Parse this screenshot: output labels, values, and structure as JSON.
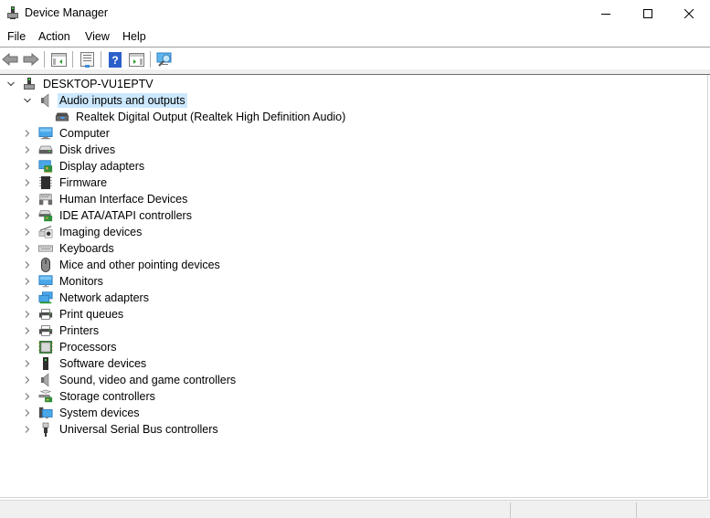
{
  "window": {
    "title": "Device Manager",
    "icon": "device-manager-icon",
    "controls": {
      "minimize": "minimize-icon",
      "maximize": "maximize-icon",
      "close": "close-icon"
    }
  },
  "menubar": {
    "items": [
      {
        "label": "File"
      },
      {
        "label": "Action"
      },
      {
        "label": "View"
      },
      {
        "label": "Help"
      }
    ]
  },
  "toolbar": {
    "buttons": [
      {
        "name": "back",
        "icon": "back-arrow-icon"
      },
      {
        "name": "forward",
        "icon": "forward-arrow-icon"
      },
      {
        "name": "show-hide-console-tree",
        "icon": "console-tree-icon"
      },
      {
        "name": "properties",
        "icon": "properties-icon"
      },
      {
        "name": "help",
        "icon": "help-icon"
      },
      {
        "name": "show-hide-action-pane",
        "icon": "action-pane-icon"
      },
      {
        "name": "scan-hardware",
        "icon": "scan-hardware-icon"
      }
    ]
  },
  "tree": {
    "root": {
      "label": "DESKTOP-VU1EPTV",
      "expanded": true,
      "icon": "computer-tower-icon"
    },
    "categories": [
      {
        "label": "Audio inputs and outputs",
        "icon": "speaker-icon",
        "expanded": true,
        "selected": true,
        "children": [
          {
            "label": "Realtek Digital Output (Realtek High Definition Audio)",
            "icon": "audio-device-icon"
          }
        ]
      },
      {
        "label": "Computer",
        "icon": "computer-icon",
        "expanded": false
      },
      {
        "label": "Disk drives",
        "icon": "disk-drive-icon",
        "expanded": false
      },
      {
        "label": "Display adapters",
        "icon": "display-adapter-icon",
        "expanded": false
      },
      {
        "label": "Firmware",
        "icon": "firmware-chip-icon",
        "expanded": false
      },
      {
        "label": "Human Interface Devices",
        "icon": "hid-icon",
        "expanded": false
      },
      {
        "label": "IDE ATA/ATAPI controllers",
        "icon": "ide-controller-icon",
        "expanded": false
      },
      {
        "label": "Imaging devices",
        "icon": "camera-icon",
        "expanded": false
      },
      {
        "label": "Keyboards",
        "icon": "keyboard-icon",
        "expanded": false
      },
      {
        "label": "Mice and other pointing devices",
        "icon": "mouse-icon",
        "expanded": false
      },
      {
        "label": "Monitors",
        "icon": "monitor-icon",
        "expanded": false
      },
      {
        "label": "Network adapters",
        "icon": "network-adapter-icon",
        "expanded": false
      },
      {
        "label": "Print queues",
        "icon": "printer-icon",
        "expanded": false
      },
      {
        "label": "Printers",
        "icon": "printer-icon",
        "expanded": false
      },
      {
        "label": "Processors",
        "icon": "processor-icon",
        "expanded": false
      },
      {
        "label": "Software devices",
        "icon": "software-device-icon",
        "expanded": false
      },
      {
        "label": "Sound, video and game controllers",
        "icon": "speaker-icon",
        "expanded": false
      },
      {
        "label": "Storage controllers",
        "icon": "storage-controller-icon",
        "expanded": false
      },
      {
        "label": "System devices",
        "icon": "system-devices-icon",
        "expanded": false
      },
      {
        "label": "Universal Serial Bus controllers",
        "icon": "usb-icon",
        "expanded": false
      }
    ]
  },
  "colors": {
    "selection": "#cce8ff",
    "statusbar": "#f0f0f0"
  }
}
